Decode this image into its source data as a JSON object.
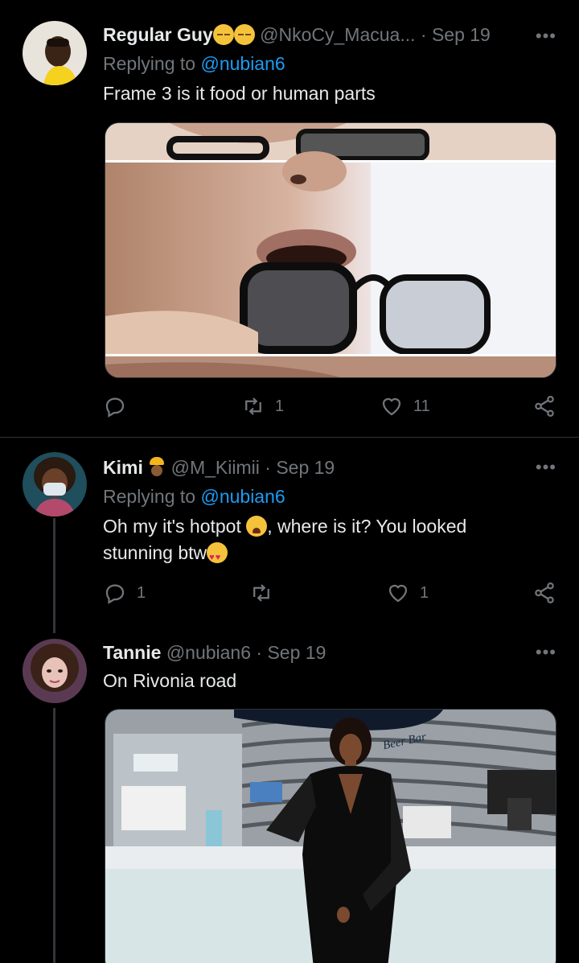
{
  "tweets": [
    {
      "name": "Regular Guy",
      "handle": "@NkoCy_Macua...",
      "date": "· Sep 19",
      "replying_prefix": "Replying to ",
      "replying_to": "@nubian6",
      "text": "Frame 3 is it food or human parts",
      "actions": {
        "reply": "",
        "retweet": "1",
        "like": "11"
      }
    },
    {
      "name": "Kimi",
      "handle": "@M_Kiimii",
      "date": "· Sep 19",
      "replying_prefix": "Replying to ",
      "replying_to": "@nubian6",
      "text_1": "Oh my it's hotpot ",
      "text_2": ", where is it? You looked stunning btw",
      "actions": {
        "reply": "1",
        "retweet": "",
        "like": "1"
      }
    },
    {
      "name": "Tannie",
      "handle": "@nubian6",
      "date": "· Sep 19",
      "text": "On Rivonia road",
      "media_sign": "Beer Bar"
    }
  ],
  "more_label": "•••",
  "colors": {
    "background": "#000000",
    "text": "#e7e9ea",
    "muted": "#71767b",
    "link": "#1d9bf0",
    "divider": "#2f3336"
  }
}
